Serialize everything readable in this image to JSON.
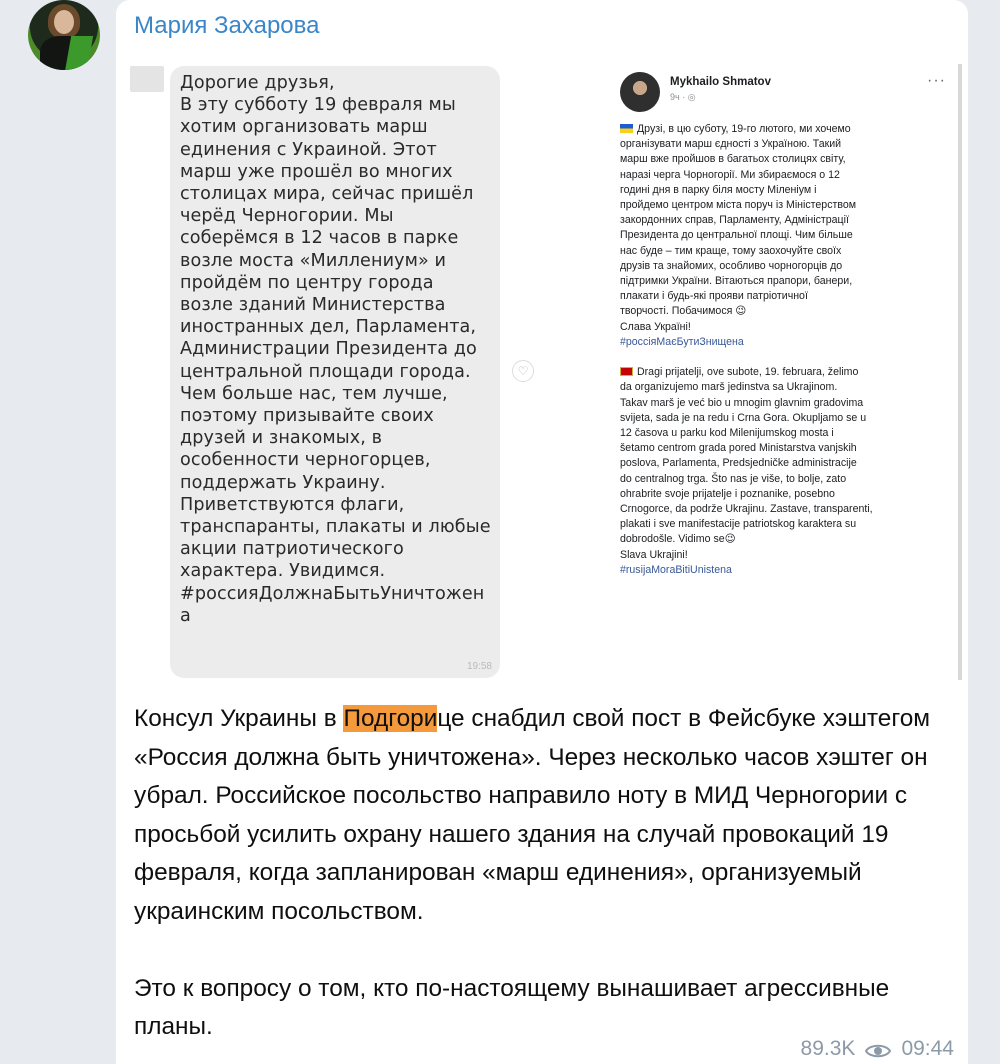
{
  "channel": {
    "sender_name": "Мария Захарова"
  },
  "media": {
    "left_message": {
      "text": "Дорогие друзья,\nВ эту субботу 19 февраля мы\nхотим организовать марш\nединения с Украиной. Этот\nмарш уже прошёл во многих\nстолицах мира, сейчас пришёл\nчерёд Черногории. Мы\nсоберёмся в 12 часов в парке\nвозле моста «Миллениум» и\nпройдём по центру города\nвозле зданий Министерства\nиностранных дел, Парламента,\nАдминистрации Президента до\nцентральной площади города.\nЧем больше нас, тем лучше,\nпоэтому призывайте своих\nдрузей и знакомых, в\nособенности черногорцев,\nподдержать Украину.\nПриветствуются флаги,\nтранспаранты, плакаты и любые\nакции патриотического\nхарактера. Увидимся.\n#россияДолжнаБытьУничтожен\nа",
      "time": "19:58"
    },
    "right_post": {
      "author": "Mykhailo Shmatov",
      "meta": "9ч · ◎",
      "body_ua": "Друзі, в цю суботу, 19-го лютого, ми хочемо\nорганізувати марш єдності з Україною. Такий\nмарш вже пройшов в багатьох столицях світу,\nнаразі черга Чорногорії. Ми збираємося о 12\nгодині дня в парку біля мосту Міленіум і\nпройдемо центром міста поруч із Міністерством\nзакордонних справ, Парламенту, Адміністрації\nПрезидента до центральної площі. Чим більше\nнас буде – тим краще, тому заохочуйте своїх\nдрузів та знайомих, особливо чорногорців до\nпідтримки України. Вітаються прапори, банери,\nплакати і будь-які прояви патріотичної\nтворчості. Побачимося 😉\nСлава Україні!",
      "tag_ua": "#россіяМаєБутиЗнищена",
      "body_me": "Dragi prijatelji, ove subote, 19. februara, želimo\nda organizujemo marš jedinstva sa Ukrajinom.\nTakav marš je već bio u mnogim glavnim gradovima\nsvijeta, sada je na redu i Crna Gora. Okupljamo se u\n12 časova u parku kod Milenijumskog mosta i\nšetamo centrom grada pored Ministarstva vanjskih\nposlova, Parlamenta, Predsjedničke administracije\ndo centralnog trga. Što nas je više, to bolje, zato\nohrabrite svoje prijatelje i poznanike, posebno\nCrnogorce, da podrže Ukrajinu. Zastave, transparenti,\nplakati i sve manifestacije patriotskog karaktera su\ndobrodošle. Vidimo se😉\nSlava Ukrajini!",
      "tag_me": "#rusijaMoraBitiUnistena"
    }
  },
  "message": {
    "para1_before": "Консул Украины в ",
    "para1_highlight": "Подгори",
    "para1_after": "це снабдил свой пост в Фейсбуке хэштегом «Россия должна быть уничтожена». Через несколько часов хэштег он убрал. Российское посольство направило ноту в МИД Черногории с просьбой усилить охрану нашего здания на случай провокаций 19 февраля, когда запланирован «марш единения», организуемый украинским посольством.",
    "para2": "Это к вопросу о том, кто по-настоящему вынашивает агрессивные планы."
  },
  "footer": {
    "views": "89.3K",
    "time": "09:44"
  },
  "colors": {
    "sender": "#3a86c8",
    "highlight": "#f59a3c",
    "meta": "#8c9aa8"
  }
}
